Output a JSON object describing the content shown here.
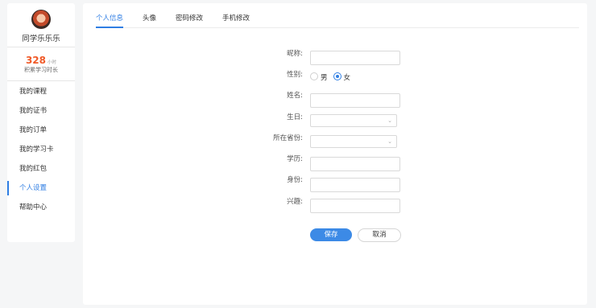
{
  "user": {
    "name": "同学乐乐乐"
  },
  "stats": {
    "hours": "328",
    "hours_unit": "小时",
    "hours_label": "积累学习时长"
  },
  "menu": [
    {
      "label": "我的课程"
    },
    {
      "label": "我的证书"
    },
    {
      "label": "我的订单"
    },
    {
      "label": "我的学习卡"
    },
    {
      "label": "我的红包"
    },
    {
      "label": "个人设置"
    },
    {
      "label": "帮助中心"
    }
  ],
  "tabs": [
    {
      "label": "个人信息"
    },
    {
      "label": "头像"
    },
    {
      "label": "密码修改"
    },
    {
      "label": "手机修改"
    }
  ],
  "form": {
    "nickname_label": "昵称:",
    "gender_label": "性别:",
    "gender_options": [
      "男",
      "女"
    ],
    "gender_selected": "女",
    "name_label": "姓名:",
    "birthday_label": "生日:",
    "province_label": "所在省份:",
    "education_label": "学历:",
    "identity_label": "身份:",
    "interest_label": "兴趣:",
    "nickname_value": "",
    "name_value": "",
    "education_value": "",
    "identity_value": "",
    "interest_value": ""
  },
  "buttons": {
    "save": "保存",
    "cancel": "取消"
  },
  "colors": {
    "accent": "#2f7ee3",
    "hours": "#f05a28"
  }
}
